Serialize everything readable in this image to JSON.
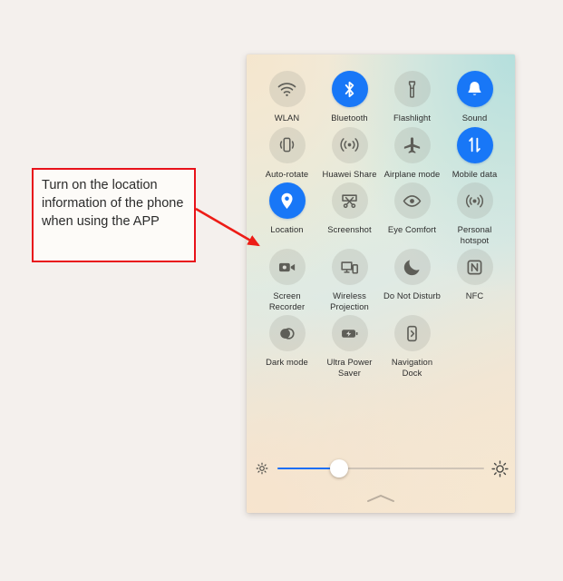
{
  "page": {
    "background_color": "#f4f0ed"
  },
  "annotation": {
    "text": "Turn on the location information of the phone when using the APP",
    "border_color": "#e8121a",
    "arrow_color": "#ed1c16",
    "arrow_target": "location-tile"
  },
  "panel": {
    "name": "android-quick-settings-panel",
    "active_color": "#1877f7",
    "inactive_color": "rgba(152,152,140,0.22)",
    "rows": [
      [
        {
          "id": "wlan",
          "label": "WLAN",
          "icon": "wifi-icon",
          "active": false
        },
        {
          "id": "bluetooth",
          "label": "Bluetooth",
          "icon": "bluetooth-icon",
          "active": true
        },
        {
          "id": "flashlight",
          "label": "Flashlight",
          "icon": "flashlight-icon",
          "active": false
        },
        {
          "id": "sound",
          "label": "Sound",
          "icon": "bell-icon",
          "active": true
        }
      ],
      [
        {
          "id": "auto-rotate",
          "label": "Auto-rotate",
          "icon": "rotate-phone-icon",
          "active": false
        },
        {
          "id": "huawei-share",
          "label": "Huawei Share",
          "icon": "broadcast-waves-icon",
          "active": false
        },
        {
          "id": "airplane-mode",
          "label": "Airplane mode",
          "icon": "airplane-icon",
          "active": false
        },
        {
          "id": "mobile-data",
          "label": "Mobile data",
          "icon": "up-down-arrows-icon",
          "active": true
        }
      ],
      [
        {
          "id": "location",
          "label": "Location",
          "icon": "location-pin-icon",
          "active": true
        },
        {
          "id": "screenshot",
          "label": "Screenshot",
          "icon": "scissors-screen-icon",
          "active": false
        },
        {
          "id": "eye-comfort",
          "label": "Eye Comfort",
          "icon": "eye-icon",
          "active": false
        },
        {
          "id": "personal-hotspot",
          "label": "Personal hotspot",
          "icon": "hotspot-icon",
          "active": false
        }
      ],
      [
        {
          "id": "screen-recorder",
          "label": "Screen Recorder",
          "icon": "video-camera-icon",
          "active": false
        },
        {
          "id": "wireless-projection",
          "label": "Wireless Projection",
          "icon": "cast-screen-icon",
          "active": false
        },
        {
          "id": "do-not-disturb",
          "label": "Do Not Disturb",
          "icon": "moon-icon",
          "active": false
        },
        {
          "id": "nfc",
          "label": "NFC",
          "icon": "nfc-icon",
          "active": false
        }
      ],
      [
        {
          "id": "dark-mode",
          "label": "Dark mode",
          "icon": "contrast-circles-icon",
          "active": false
        },
        {
          "id": "ultra-power-saver",
          "label": "Ultra Power Saver",
          "icon": "battery-bolt-icon",
          "active": false
        },
        {
          "id": "navigation-dock",
          "label": "Navigation Dock",
          "icon": "nav-dock-icon",
          "active": false
        }
      ]
    ],
    "brightness": {
      "name": "brightness-slider",
      "value_percent": 30,
      "left_icon": "sun-small-icon",
      "right_icon": "sun-large-icon",
      "fill_color": "#1a6ef5",
      "track_color": "#cfc4b7"
    },
    "handle_icon": "chevron-up-icon"
  }
}
